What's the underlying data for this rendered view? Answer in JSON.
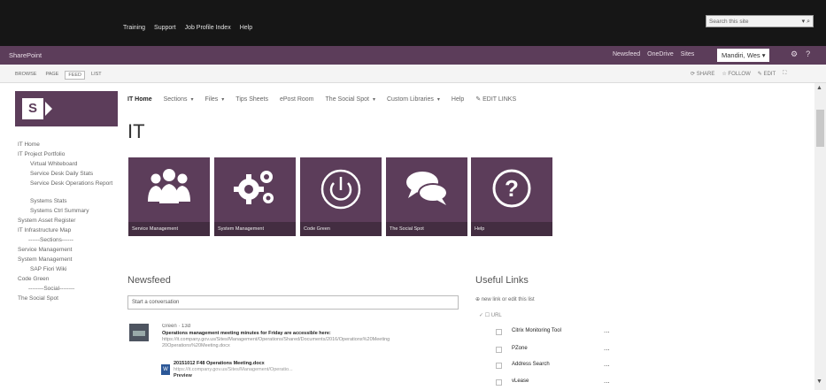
{
  "topbar": {
    "links": [
      "Training",
      "Support",
      "Job Profile Index",
      "Help"
    ],
    "search_placeholder": "Search this site"
  },
  "suitebar": {
    "brand": "SharePoint",
    "links": [
      "Newsfeed",
      "OneDrive",
      "Sites"
    ],
    "user": "Mandiri, Wes",
    "icons": [
      "gear-icon",
      "help-icon"
    ]
  },
  "ribbon": {
    "tabs": [
      "BROWSE",
      "PAGE",
      "FEED",
      "LIST"
    ],
    "active_tab": "FEED",
    "actions": [
      "SHARE",
      "FOLLOW",
      "EDIT"
    ]
  },
  "site_nav": {
    "items": [
      {
        "label": "IT Home",
        "current": true,
        "dropdown": false
      },
      {
        "label": "Sections",
        "current": false,
        "dropdown": true
      },
      {
        "label": "Files",
        "current": false,
        "dropdown": true
      },
      {
        "label": "Tips Sheets",
        "current": false,
        "dropdown": false
      },
      {
        "label": "ePost Room",
        "current": false,
        "dropdown": false
      },
      {
        "label": "The Social Spot",
        "current": false,
        "dropdown": true
      },
      {
        "label": "Custom Libraries",
        "current": false,
        "dropdown": true
      },
      {
        "label": "Help",
        "current": false,
        "dropdown": false
      }
    ],
    "edit_links": "EDIT LINKS"
  },
  "page_title": "IT",
  "left_nav": [
    {
      "label": "IT Home",
      "type": "item"
    },
    {
      "label": "IT Project Portfolio",
      "type": "item"
    },
    {
      "label": "Virtual Whiteboard",
      "type": "sub"
    },
    {
      "label": "Service Desk Daily Stats",
      "type": "sub"
    },
    {
      "label": "Service Desk Operations Report",
      "type": "sub-wrap"
    },
    {
      "label": "Systems Stats",
      "type": "sub"
    },
    {
      "label": "Systems Ctrl Summary",
      "type": "sub"
    },
    {
      "label": "System Asset Register",
      "type": "item"
    },
    {
      "label": "IT Infrastructure Map",
      "type": "item"
    },
    {
      "label": "------Sections------",
      "type": "sep"
    },
    {
      "label": "Service Management",
      "type": "item"
    },
    {
      "label": "System Management",
      "type": "item"
    },
    {
      "label": "SAP Fiori Wiki",
      "type": "sub"
    },
    {
      "label": "Code Green",
      "type": "item"
    },
    {
      "label": "--------Social--------",
      "type": "sep"
    },
    {
      "label": "The Social Spot",
      "type": "item"
    }
  ],
  "tiles": [
    {
      "label": "Service Management",
      "icon": "people-icon"
    },
    {
      "label": "System Management",
      "icon": "gears-icon"
    },
    {
      "label": "Code Green",
      "icon": "power-icon"
    },
    {
      "label": "The Social Spot",
      "icon": "chat-icon"
    },
    {
      "label": "Help",
      "icon": "question-icon"
    }
  ],
  "newsfeed": {
    "title": "Newsfeed",
    "input_placeholder": "Start a conversation",
    "post": {
      "author": "Green",
      "time": "13d",
      "body": "Operations management meeting minutes for Friday are accessible here:",
      "link1": "https://it.company.gov.us/Sites/Management/Operations/Shared/Documents/2016/Operations%20Meeting",
      "link2": "20Operations%20Meeting.docx",
      "doc_name": "20151012 F48 Operations Meeting.docx",
      "doc_url": "https://it.company.gov.us/Sites/Management/Operatio...",
      "preview": "Preview"
    }
  },
  "useful_links": {
    "title": "Useful Links",
    "new_item": "new link or edit this list",
    "column_header": "URL",
    "items": [
      "Citrix Monitoring Tool",
      "PZone",
      "Address Search",
      "vLease"
    ],
    "more": "..."
  }
}
